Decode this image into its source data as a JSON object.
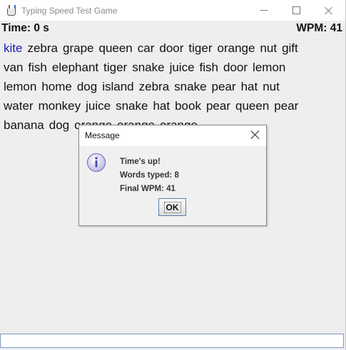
{
  "window": {
    "title": "Typing Speed Test Game",
    "icon": "java-cup-icon"
  },
  "status": {
    "time_label": "Time: 0 s",
    "wpm_label": "WPM: 41"
  },
  "word_lines": [
    [
      "kite",
      "zebra",
      "grape",
      "queen",
      "car",
      "door",
      "tiger",
      "orange",
      "nut",
      "gift"
    ],
    [
      "van",
      "fish",
      "elephant",
      "tiger",
      "snake",
      "juice",
      "fish",
      "door",
      "lemon"
    ],
    [
      "lemon",
      "home",
      "dog",
      "island",
      "zebra",
      "snake",
      "pear",
      "hat",
      "nut"
    ],
    [
      "water",
      "monkey",
      "juice",
      "snake",
      "hat",
      "book",
      "pear",
      "queen",
      "pear"
    ],
    [
      "banana",
      "dog",
      "orange",
      "orange",
      "orange"
    ]
  ],
  "current_word": "kite",
  "colors": {
    "current_word": "#1a1ab0",
    "window_bg": "#eeeeee"
  },
  "input": {
    "value": ""
  },
  "dialog": {
    "title": "Message",
    "icon": "info-icon",
    "lines": [
      "Time's up!",
      "Words typed: 8",
      "Final WPM: 41"
    ],
    "ok_label": "OK"
  }
}
